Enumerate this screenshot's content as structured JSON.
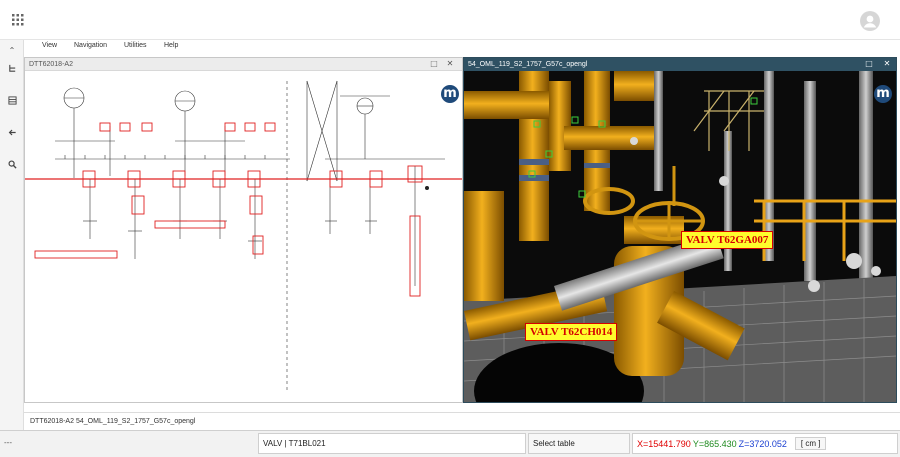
{
  "menu": [
    "View",
    "Navigation",
    "Utilities",
    "Help"
  ],
  "panes": {
    "left": {
      "title": "DTT62018-A2",
      "restore_icon": "□",
      "close_icon": "✕"
    },
    "right": {
      "title": "54_OML_119_S2_1757_G57c_opengl",
      "restore_icon": "□",
      "close_icon": "✕"
    }
  },
  "viewer": {
    "logo_letter": "m",
    "labels": [
      {
        "text": "VALV T62GA007"
      },
      {
        "text": "VALV T62CH014"
      }
    ]
  },
  "tabs": [
    "DTT62018-A2",
    "54_OML_119_S2_1757_G57c_opengl"
  ],
  "status": {
    "left_text": "---",
    "selection": "VALV | T71BL021",
    "table_button": "Select table",
    "x": "X=15441.790",
    "y": "Y=865.430",
    "z": "Z=3720.052",
    "unit": "[ cm ]",
    "colors": {
      "x": "#e00000",
      "y": "#1e8a1e",
      "z": "#1a3fd1"
    }
  },
  "rail": {
    "collapse_icon": "⌃",
    "items": [
      "tree-icon",
      "layers-icon",
      "back-arrow-icon",
      "search-icon"
    ]
  },
  "colors": {
    "pane_header_dark": "#2f5163",
    "pid_red": "#e02020",
    "label_yellow": "#fffc2c"
  }
}
